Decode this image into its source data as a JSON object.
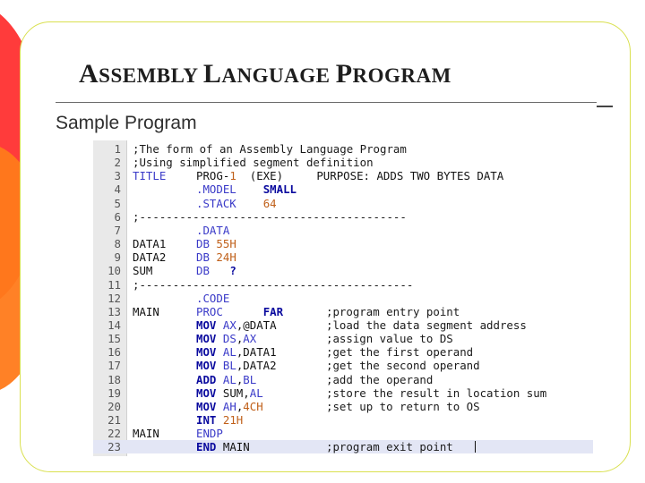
{
  "slide": {
    "title_parts": [
      {
        "text": "A",
        "size": "cap"
      },
      {
        "text": "SSEMBLY ",
        "size": "sm"
      },
      {
        "text": "L",
        "size": "cap"
      },
      {
        "text": "ANGUAGE ",
        "size": "sm"
      },
      {
        "text": "P",
        "size": "cap"
      },
      {
        "text": "ROGRAM",
        "size": "sm"
      }
    ],
    "subtitle": "Sample Program"
  },
  "colors": {
    "red_shape": "#ff3b3b",
    "orange_shape": "#ff7a1a",
    "frame_border": "#d9e04f",
    "keyword": "#3a3ac8",
    "bold_keyword": "#0a0a9e",
    "number": "#c0601a",
    "highlight_line": "#e3e6f5"
  },
  "code": {
    "highlighted_line": 23,
    "lines": [
      {
        "n": "1",
        "segs": [
          {
            "t": ";The form of an Assembly Language Program",
            "s": "cmt",
            "c": "c1"
          }
        ]
      },
      {
        "n": "2",
        "segs": [
          {
            "t": ";Using simplified segment definition",
            "s": "cmt",
            "c": "c1"
          }
        ]
      },
      {
        "n": "3",
        "segs": [
          {
            "t": "TITLE",
            "s": "kw",
            "c": "c1"
          },
          {
            "t": "PROG-",
            "s": "plain",
            "c": "c2"
          },
          {
            "t": "1",
            "s": "num",
            "c": "c2",
            "off": 5
          },
          {
            "t": "  (EXE)     PURPOSE: ADDS TWO BYTES DATA",
            "s": "plain",
            "c": "c2",
            "off": 6
          }
        ]
      },
      {
        "n": "4",
        "segs": [
          {
            "t": ".MODEL",
            "s": "kw",
            "c": "c2"
          },
          {
            "t": "SMALL",
            "s": "bold",
            "c": "c2",
            "off": 10
          }
        ]
      },
      {
        "n": "5",
        "segs": [
          {
            "t": ".STACK",
            "s": "kw",
            "c": "c2"
          },
          {
            "t": "64",
            "s": "num",
            "c": "c2",
            "off": 10
          }
        ]
      },
      {
        "n": "6",
        "segs": [
          {
            "t": ";----------------------------------------",
            "s": "cmt",
            "c": "c1"
          }
        ]
      },
      {
        "n": "7",
        "segs": [
          {
            "t": ".DATA",
            "s": "kw",
            "c": "c2"
          }
        ]
      },
      {
        "n": "8",
        "segs": [
          {
            "t": "DATA1",
            "s": "lab",
            "c": "c1"
          },
          {
            "t": "DB",
            "s": "kw",
            "c": "c2"
          },
          {
            "t": "55H",
            "s": "num",
            "c": "c2",
            "off": 3
          }
        ]
      },
      {
        "n": "9",
        "segs": [
          {
            "t": "DATA2",
            "s": "lab",
            "c": "c1"
          },
          {
            "t": "DB",
            "s": "kw",
            "c": "c2"
          },
          {
            "t": "24H",
            "s": "num",
            "c": "c2",
            "off": 3
          }
        ]
      },
      {
        "n": "10",
        "segs": [
          {
            "t": "SUM",
            "s": "lab",
            "c": "c1"
          },
          {
            "t": "DB",
            "s": "kw",
            "c": "c2"
          },
          {
            "t": "?",
            "s": "bold",
            "c": "c2",
            "off": 5
          }
        ]
      },
      {
        "n": "11",
        "segs": [
          {
            "t": ";-----------------------------------------",
            "s": "cmt",
            "c": "c1"
          }
        ]
      },
      {
        "n": "12",
        "segs": [
          {
            "t": ".CODE",
            "s": "kw",
            "c": "c2"
          }
        ]
      },
      {
        "n": "13",
        "segs": [
          {
            "t": "MAIN",
            "s": "lab",
            "c": "c1"
          },
          {
            "t": "PROC",
            "s": "kw",
            "c": "c2"
          },
          {
            "t": "FAR",
            "s": "bold",
            "c": "c2",
            "off": 10
          },
          {
            "t": ";program entry point",
            "s": "cmt",
            "c": "c3"
          }
        ]
      },
      {
        "n": "14",
        "segs": [
          {
            "t": "MOV",
            "s": "bold",
            "c": "c2"
          },
          {
            "t": "AX",
            "s": "kw",
            "c": "c2",
            "off": 4
          },
          {
            "t": ",@DATA",
            "s": "plain",
            "c": "c2",
            "off": 6
          },
          {
            "t": ";load the data segment address",
            "s": "cmt",
            "c": "c3"
          }
        ]
      },
      {
        "n": "15",
        "segs": [
          {
            "t": "MOV",
            "s": "bold",
            "c": "c2"
          },
          {
            "t": "DS",
            "s": "kw",
            "c": "c2",
            "off": 4
          },
          {
            "t": ",",
            "s": "plain",
            "c": "c2",
            "off": 6
          },
          {
            "t": "AX",
            "s": "kw",
            "c": "c2",
            "off": 7
          },
          {
            "t": ";assign value to DS",
            "s": "cmt",
            "c": "c3"
          }
        ]
      },
      {
        "n": "16",
        "segs": [
          {
            "t": "MOV",
            "s": "bold",
            "c": "c2"
          },
          {
            "t": "AL",
            "s": "kw",
            "c": "c2",
            "off": 4
          },
          {
            "t": ",DATA1",
            "s": "plain",
            "c": "c2",
            "off": 6
          },
          {
            "t": ";get the first operand",
            "s": "cmt",
            "c": "c3"
          }
        ]
      },
      {
        "n": "17",
        "segs": [
          {
            "t": "MOV",
            "s": "bold",
            "c": "c2"
          },
          {
            "t": "BL",
            "s": "kw",
            "c": "c2",
            "off": 4
          },
          {
            "t": ",DATA2",
            "s": "plain",
            "c": "c2",
            "off": 6
          },
          {
            "t": ";get the second operand",
            "s": "cmt",
            "c": "c3"
          }
        ]
      },
      {
        "n": "18",
        "segs": [
          {
            "t": "ADD",
            "s": "bold",
            "c": "c2"
          },
          {
            "t": "AL",
            "s": "kw",
            "c": "c2",
            "off": 4
          },
          {
            "t": ",",
            "s": "plain",
            "c": "c2",
            "off": 6
          },
          {
            "t": "BL",
            "s": "kw",
            "c": "c2",
            "off": 7
          },
          {
            "t": ";add the operand",
            "s": "cmt",
            "c": "c3"
          }
        ]
      },
      {
        "n": "19",
        "segs": [
          {
            "t": "MOV",
            "s": "bold",
            "c": "c2"
          },
          {
            "t": "SUM,",
            "s": "plain",
            "c": "c2",
            "off": 4
          },
          {
            "t": "AL",
            "s": "kw",
            "c": "c2",
            "off": 8
          },
          {
            "t": ";store the result in location sum",
            "s": "cmt",
            "c": "c3"
          }
        ]
      },
      {
        "n": "20",
        "segs": [
          {
            "t": "MOV",
            "s": "bold",
            "c": "c2"
          },
          {
            "t": "AH",
            "s": "kw",
            "c": "c2",
            "off": 4
          },
          {
            "t": ",",
            "s": "plain",
            "c": "c2",
            "off": 6
          },
          {
            "t": "4CH",
            "s": "num",
            "c": "c2",
            "off": 7
          },
          {
            "t": ";set up to return to OS",
            "s": "cmt",
            "c": "c3"
          }
        ]
      },
      {
        "n": "21",
        "segs": [
          {
            "t": "INT",
            "s": "bold",
            "c": "c2"
          },
          {
            "t": "21H",
            "s": "num",
            "c": "c2",
            "off": 4
          }
        ]
      },
      {
        "n": "22",
        "segs": [
          {
            "t": "MAIN",
            "s": "lab",
            "c": "c1"
          },
          {
            "t": "ENDP",
            "s": "kw",
            "c": "c2"
          }
        ]
      },
      {
        "n": "23",
        "segs": [
          {
            "t": "END",
            "s": "bold",
            "c": "c2"
          },
          {
            "t": "MAIN",
            "s": "plain",
            "c": "c2",
            "off": 4
          },
          {
            "t": ";program exit point",
            "s": "cmt",
            "c": "c3"
          }
        ]
      }
    ]
  }
}
